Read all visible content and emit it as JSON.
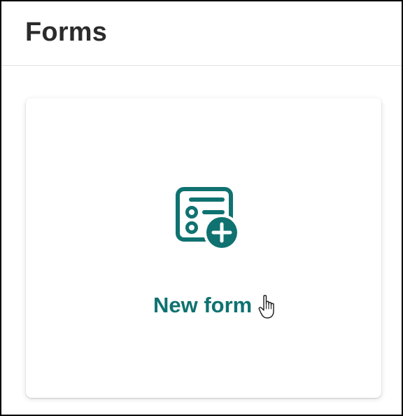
{
  "header": {
    "title": "Forms"
  },
  "card": {
    "label": "New form",
    "icon": "new-form-icon",
    "cursor": "hand-pointer-icon"
  },
  "colors": {
    "accent": "#0f7270",
    "title_text": "#2b2b2b",
    "divider": "#e1e1e1",
    "background": "#ffffff"
  }
}
